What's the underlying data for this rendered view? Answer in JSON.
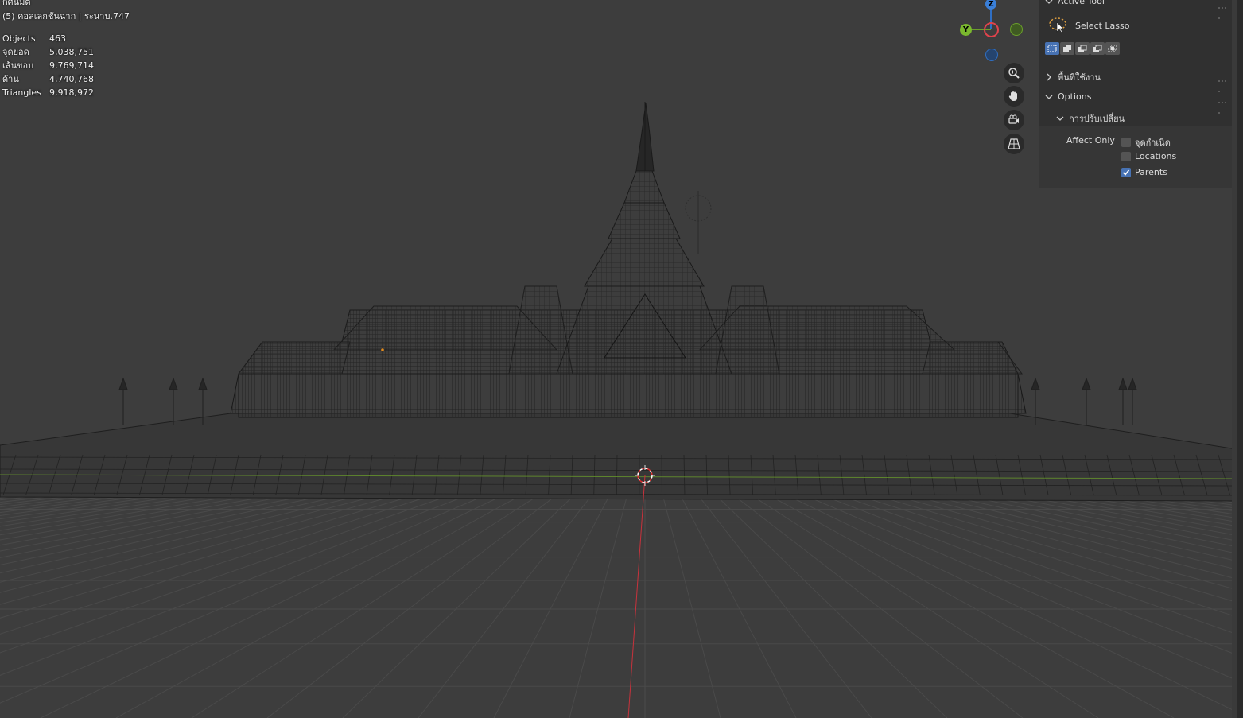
{
  "overlay": {
    "line1": "กศนมต",
    "line2": "(5) คอลเลกชันฉาก | ระนาบ.747"
  },
  "stats": [
    {
      "label": "Objects",
      "value": "463"
    },
    {
      "label": "จุดยอด",
      "value": "5,038,751"
    },
    {
      "label": "เส้นขอบ",
      "value": "9,769,714"
    },
    {
      "label": "ด้าน",
      "value": "4,740,768"
    },
    {
      "label": "Triangles",
      "value": "9,918,972"
    }
  ],
  "gizmo": {
    "z": "Z",
    "y": "Y"
  },
  "nav_icons": [
    "zoom-icon",
    "hand-pan-icon",
    "camera-icon",
    "grid-perspective-icon"
  ],
  "panel": {
    "active_tool_label": "Active Tool",
    "tool_name": "Select Lasso",
    "workspace_label": "พื้นที่ใช้งาน",
    "options_label": "Options",
    "transform_label": "การปรับเปลี่ยน",
    "affect_only_label": "Affect Only",
    "affect_options": [
      {
        "label": "จุดกำเนิด",
        "checked": false
      },
      {
        "label": "Locations",
        "checked": false
      },
      {
        "label": "Parents",
        "checked": true
      }
    ]
  },
  "colors": {
    "viewport_bg": "#3d3d3d",
    "grid": "#4a4a4a",
    "x_axis": "#c8323c",
    "y_axis": "#6ba02a",
    "z_axis": "#2f6fc4",
    "accent": "#4772b3"
  }
}
